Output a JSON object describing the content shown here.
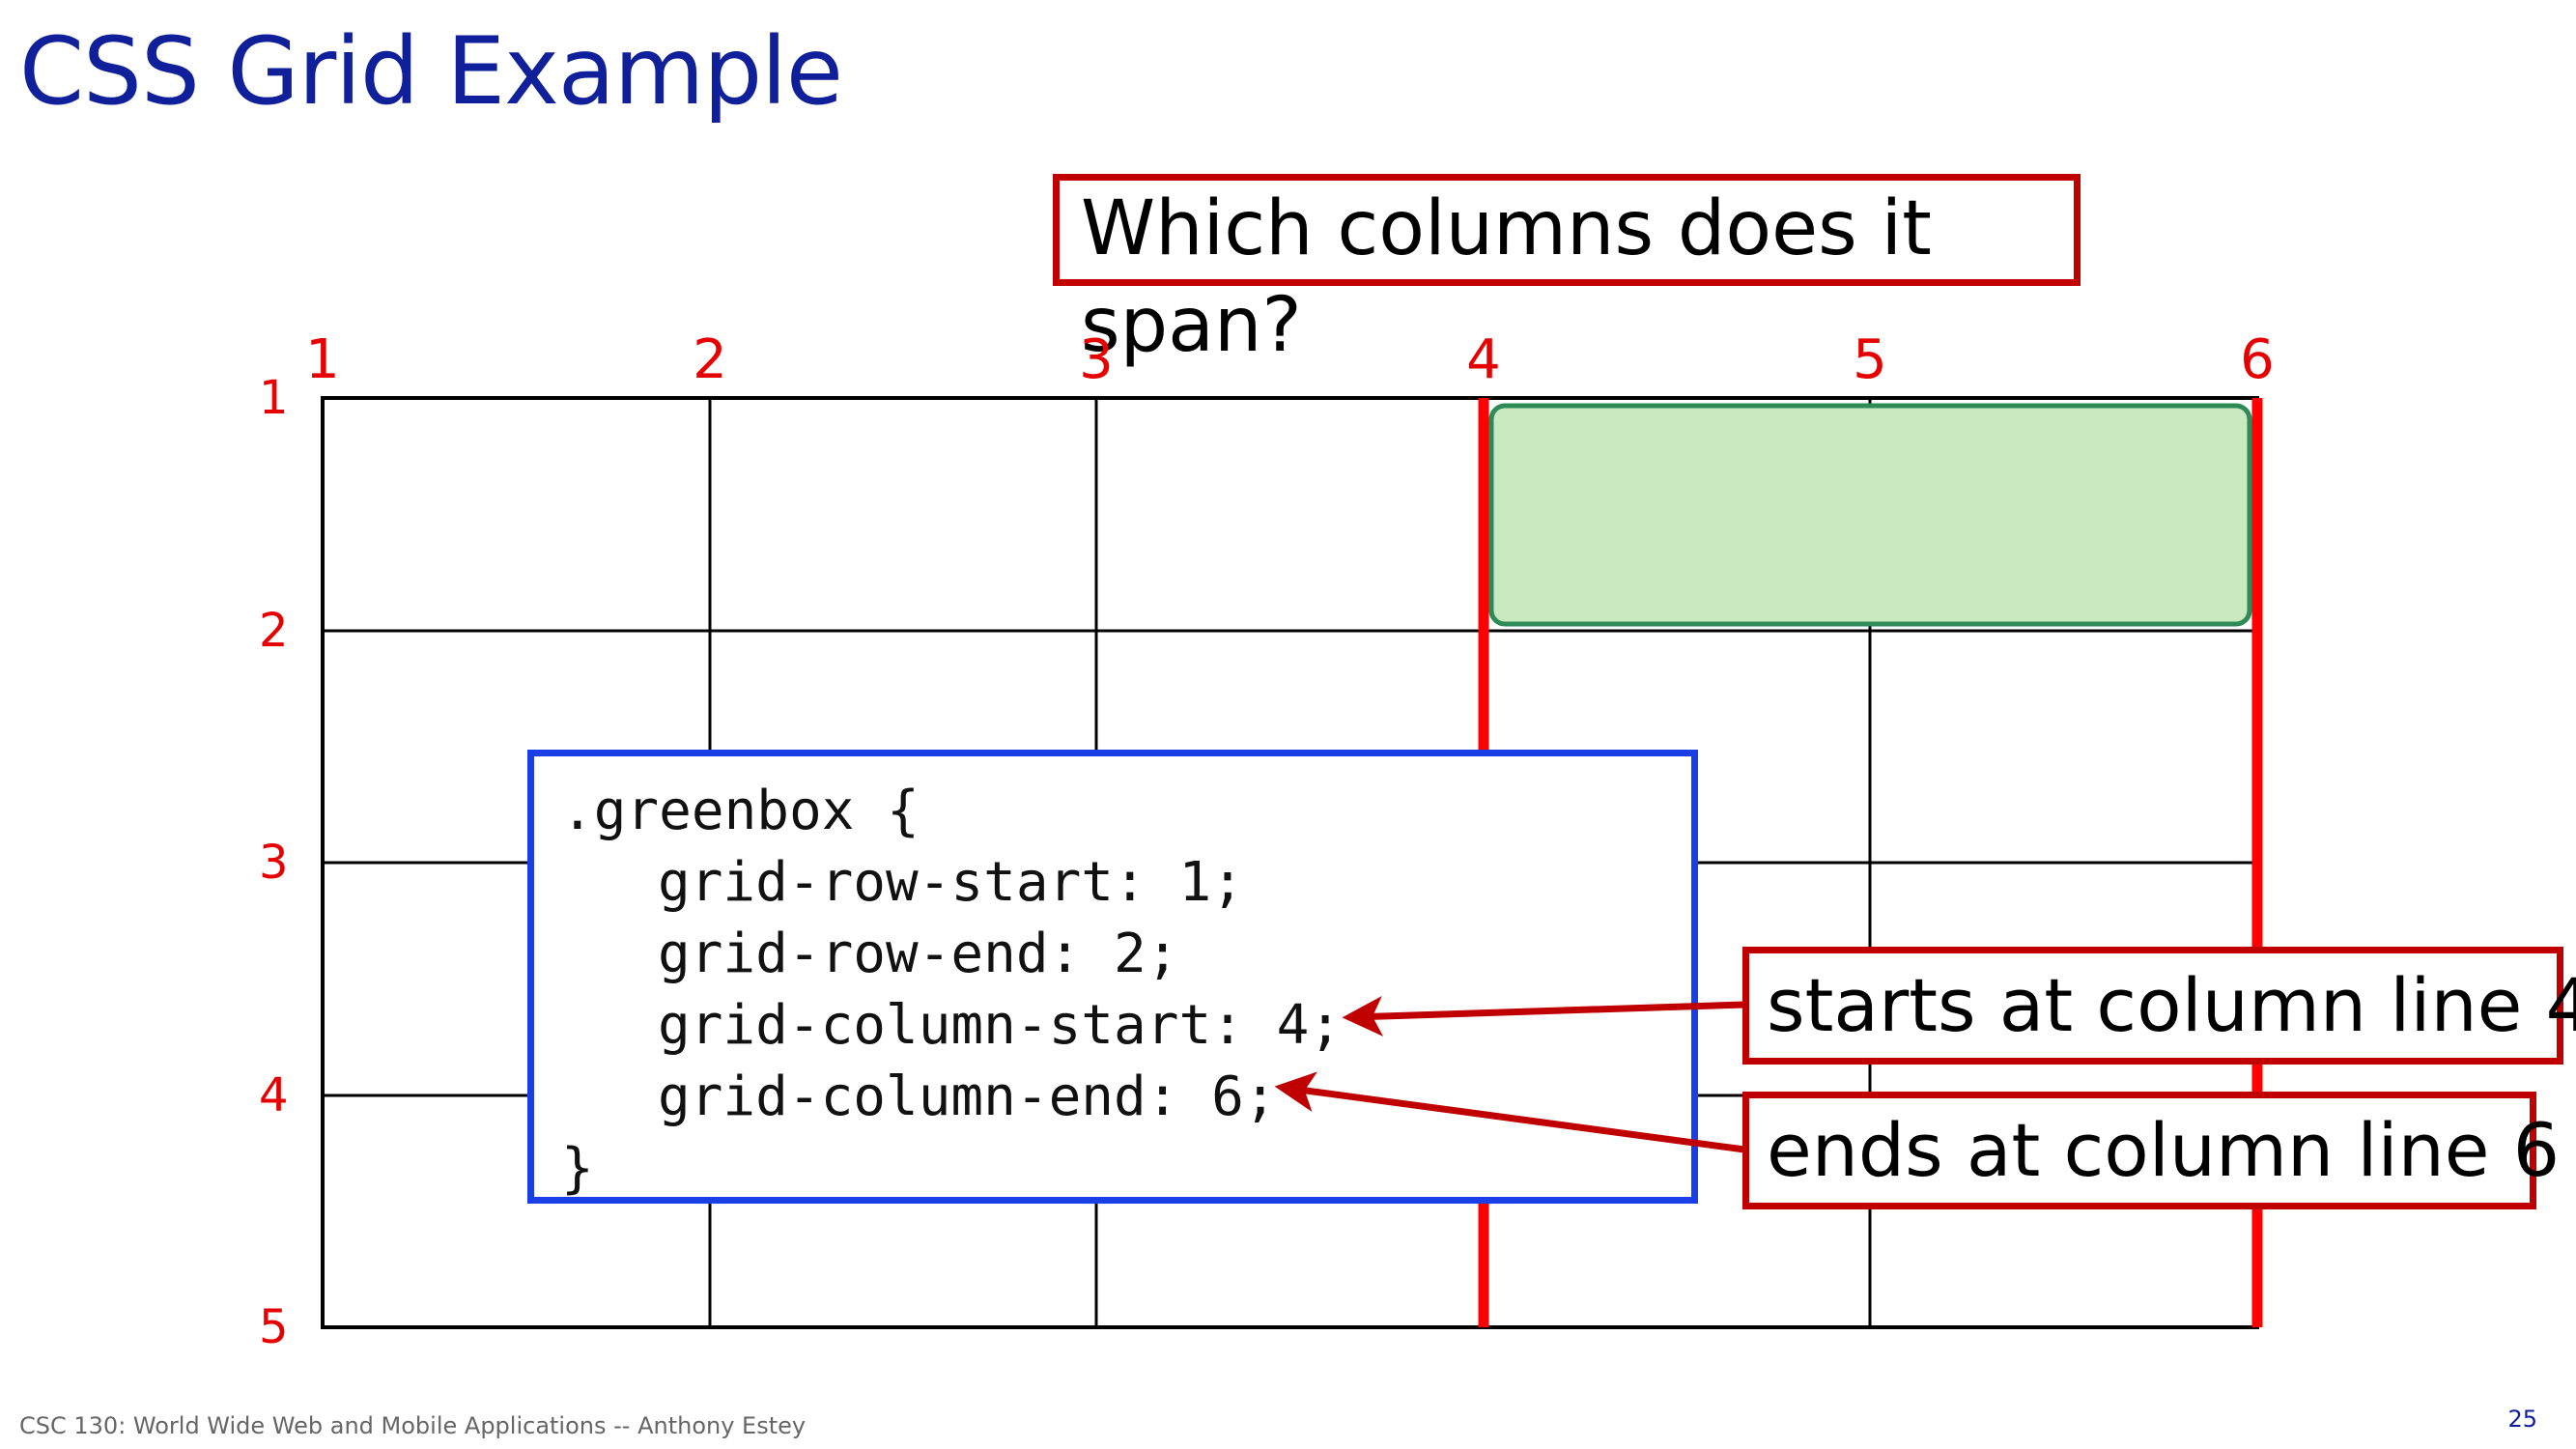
{
  "slide": {
    "title": "CSS Grid Example",
    "question": "Which columns does it span?",
    "column_lines": [
      "1",
      "2",
      "3",
      "4",
      "5",
      "6"
    ],
    "row_lines": [
      "1",
      "2",
      "3",
      "4",
      "5"
    ],
    "code": {
      "open": ".greenbox {",
      "lines": [
        "grid-row-start: 1;",
        "grid-row-end: 2;",
        "grid-column-start: 4;",
        "grid-column-end: 6;"
      ],
      "close": "}"
    },
    "callout_start": "starts at column line 4",
    "callout_end": "ends at column line 6",
    "footer": "CSC 130: World Wide Web and Mobile Applications -- Anthony Estey",
    "page_number": "25"
  },
  "colors": {
    "title": "#10209a",
    "highlight_line": "#ff0000",
    "callout_border": "#c00000",
    "code_border": "#1a3fe6",
    "green_box_fill": "#cbe9c0",
    "green_box_border": "#2e8b57"
  }
}
